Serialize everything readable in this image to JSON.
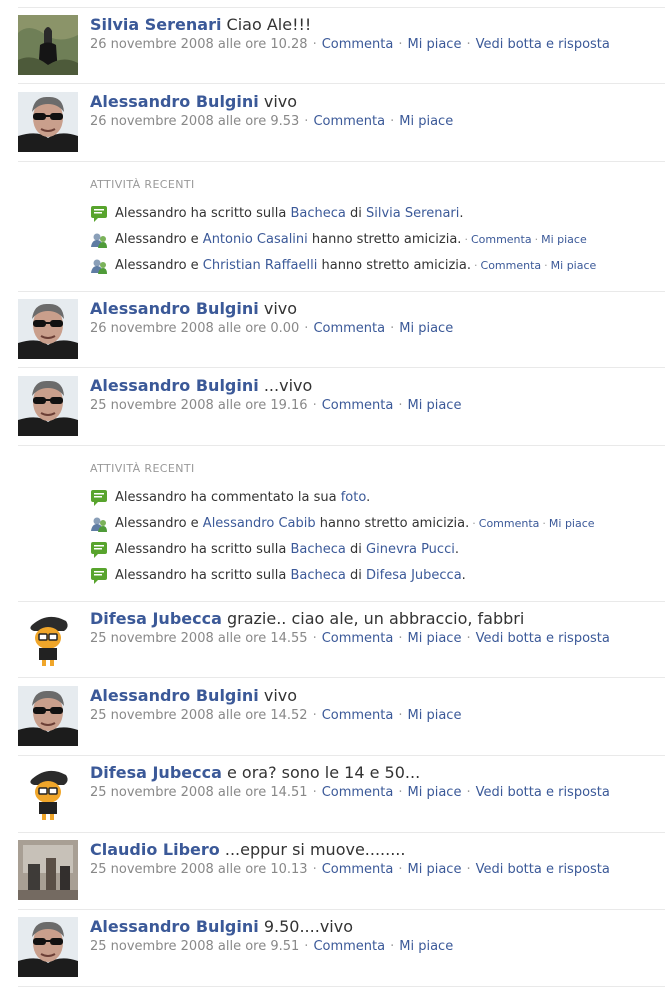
{
  "meta_sep": "·",
  "posts": [
    {
      "name": "Silvia Serenari",
      "msg": "Ciao Ale!!!",
      "date": "26 novembre 2008 alle ore 10.28",
      "comment": "Commenta",
      "like": "Mi piace",
      "wall": "Vedi botta e risposta"
    },
    {
      "name": "Alessandro Bulgini",
      "msg": "vivo",
      "date": "26 novembre 2008 alle ore 9.53",
      "comment": "Commenta",
      "like": "Mi piace"
    },
    {
      "name": "Alessandro Bulgini",
      "msg": "vivo",
      "date": "26 novembre 2008 alle ore 0.00",
      "comment": "Commenta",
      "like": "Mi piace"
    },
    {
      "name": "Alessandro Bulgini",
      "msg": "...vivo",
      "date": "25 novembre 2008 alle ore 19.16",
      "comment": "Commenta",
      "like": "Mi piace"
    },
    {
      "name": "Difesa Jubecca",
      "msg": "grazie.. ciao ale, un abbraccio, fabbri",
      "date": "25 novembre 2008 alle ore 14.55",
      "comment": "Commenta",
      "like": "Mi piace",
      "wall": "Vedi botta e risposta"
    },
    {
      "name": "Alessandro Bulgini",
      "msg": "vivo",
      "date": "25 novembre 2008 alle ore 14.52",
      "comment": "Commenta",
      "like": "Mi piace"
    },
    {
      "name": "Difesa Jubecca",
      "msg": "e ora? sono le 14 e 50...",
      "date": "25 novembre 2008 alle ore 14.51",
      "comment": "Commenta",
      "like": "Mi piace",
      "wall": "Vedi botta e risposta"
    },
    {
      "name": "Claudio Libero",
      "msg": "...eppur si muove........",
      "date": "25 novembre 2008 alle ore 10.13",
      "comment": "Commenta",
      "like": "Mi piace",
      "wall": "Vedi botta e risposta"
    },
    {
      "name": "Alessandro Bulgini",
      "msg": "9.50....vivo",
      "date": "25 novembre 2008 alle ore 9.51",
      "comment": "Commenta",
      "like": "Mi piace"
    }
  ],
  "activity1": {
    "title": "ATTIVITÀ RECENTI",
    "r1": {
      "a": "Alessandro ha scritto sulla ",
      "l1": "Bacheca",
      "b": " di ",
      "l2": "Silvia Serenari",
      "c": "."
    },
    "r2": {
      "a": "Alessandro e ",
      "l1": "Antonio Casalini",
      "b": " hanno stretto amicizia.",
      "comment": "Commenta",
      "like": "Mi piace"
    },
    "r3": {
      "a": "Alessandro e ",
      "l1": "Christian Raffaelli",
      "b": " hanno stretto amicizia.",
      "comment": "Commenta",
      "like": "Mi piace"
    }
  },
  "activity2": {
    "title": "ATTIVITÀ RECENTI",
    "r1": {
      "a": "Alessandro ha commentato la sua ",
      "l1": "foto",
      "b": "."
    },
    "r2": {
      "a": "Alessandro e ",
      "l1": "Alessandro Cabib",
      "b": " hanno stretto amicizia.",
      "comment": "Commenta",
      "like": "Mi piace"
    },
    "r3": {
      "a": "Alessandro ha scritto sulla ",
      "l1": "Bacheca",
      "b": " di ",
      "l2": "Ginevra Pucci",
      "c": "."
    },
    "r4": {
      "a": "Alessandro ha scritto sulla ",
      "l1": "Bacheca",
      "b": " di ",
      "l2": "Difesa Jubecca",
      "c": "."
    }
  }
}
